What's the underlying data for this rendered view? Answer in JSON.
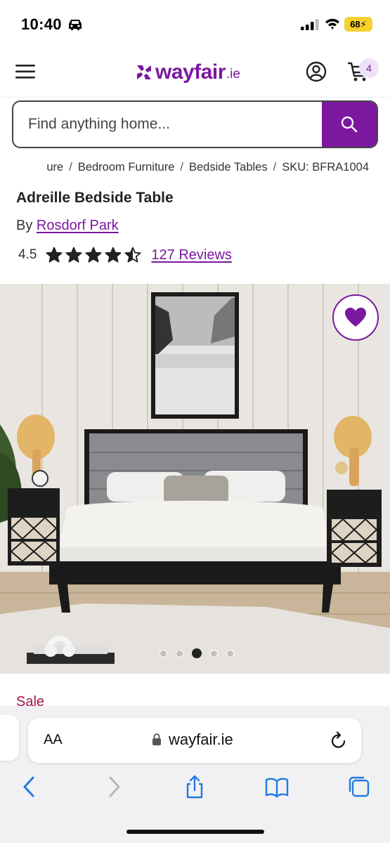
{
  "status_bar": {
    "time": "10:40",
    "battery": "68"
  },
  "header": {
    "logo_text": "wayfair",
    "logo_suffix": ".ie",
    "cart_count": "4"
  },
  "search": {
    "placeholder": "Find anything home..."
  },
  "breadcrumb": [
    "ure",
    "Bedroom Furniture",
    "Bedside Tables",
    "SKU: BFRA1004"
  ],
  "breadcrumb_separator": "/",
  "product": {
    "title": "Adreille Bedside Table",
    "by_label": "By",
    "brand": "Rosdorf Park",
    "rating": "4.5",
    "rating_value": 4.5,
    "rating_max": 5,
    "reviews_label": "127 Reviews",
    "sale_label": "Sale"
  },
  "carousel": {
    "count": 5,
    "active_index": 2
  },
  "safari": {
    "aa_label": "AA",
    "url": "wayfair.ie"
  },
  "colors": {
    "brand_purple": "#7b189f",
    "sale_red": "#a3124d",
    "ios_blue": "#1f7ae0"
  },
  "icons": {
    "menu": "hamburger-menu-icon",
    "account": "account-icon",
    "cart": "cart-icon",
    "search": "search-icon",
    "favorite": "heart-icon",
    "back": "chevron-left-icon",
    "forward": "chevron-right-icon",
    "share": "share-icon",
    "bookmarks": "book-icon",
    "tabs": "tabs-icon",
    "reload": "reload-icon",
    "lock": "lock-icon"
  }
}
